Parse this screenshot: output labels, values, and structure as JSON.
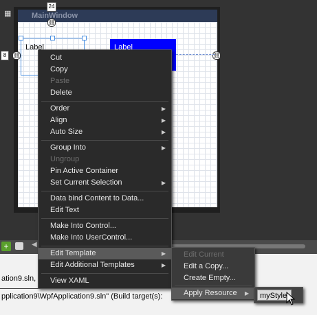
{
  "window": {
    "title": "MainWindow"
  },
  "ruler": {
    "top_value": "24",
    "left_value": "8"
  },
  "canvas": {
    "label1": "Label",
    "label2": "Label"
  },
  "colors": {
    "menu_bg": "#2a2a2a",
    "label2_bg": "#0000ff",
    "highlight": "#5a5a5a"
  },
  "context_menu": {
    "items": [
      {
        "label": "Cut",
        "disabled": false
      },
      {
        "label": "Copy",
        "disabled": false
      },
      {
        "label": "Paste",
        "disabled": true
      },
      {
        "label": "Delete",
        "disabled": false
      },
      {
        "label": "Order",
        "submenu": true
      },
      {
        "label": "Align",
        "submenu": true
      },
      {
        "label": "Auto Size",
        "submenu": true
      },
      {
        "label": "Group Into",
        "submenu": true
      },
      {
        "label": "Ungroup",
        "disabled": true
      },
      {
        "label": "Pin Active Container"
      },
      {
        "label": "Set Current Selection",
        "submenu": true
      },
      {
        "label": "Data bind Content to Data..."
      },
      {
        "label": "Edit Text"
      },
      {
        "label": "Make Into Control..."
      },
      {
        "label": "Make Into UserControl..."
      },
      {
        "label": "Edit Template",
        "submenu": true,
        "highlighted": true
      },
      {
        "label": "Edit Additional Templates",
        "submenu": true
      },
      {
        "label": "View XAML"
      }
    ]
  },
  "template_submenu": {
    "items": [
      {
        "label": "Edit Current",
        "disabled": true
      },
      {
        "label": "Edit a Copy..."
      },
      {
        "label": "Create Empty..."
      },
      {
        "label": "Apply Resource",
        "submenu": true,
        "highlighted": true
      }
    ]
  },
  "resource_submenu": {
    "items": [
      {
        "label": "myStyle"
      }
    ]
  },
  "output": {
    "line1": "ation9.sln, T",
    "line2": "pplication9\\WpfApplication9.sln\" (Build target(s):"
  },
  "icons": [
    "grid-toggle-icon",
    "add-icon",
    "comment-icon",
    "chevron-left-icon",
    "submenu-arrow-icon",
    "mouse-cursor-icon"
  ]
}
